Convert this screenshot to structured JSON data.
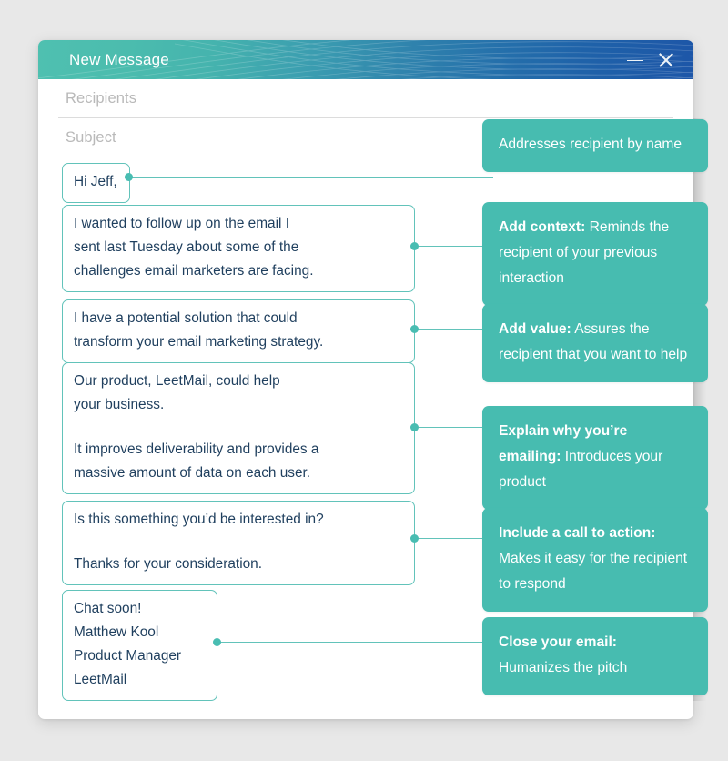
{
  "window": {
    "title": "New Message",
    "controls": [
      {
        "name": "minimize",
        "glyph": "—"
      },
      {
        "name": "close",
        "glyph": "✕"
      }
    ]
  },
  "fields": [
    {
      "name": "recipients",
      "placeholder": "Recipients",
      "value": ""
    },
    {
      "name": "subject",
      "placeholder": "Subject",
      "value": ""
    }
  ],
  "email_blocks": [
    {
      "id": "greeting",
      "lines": [
        "Hi Jeff,"
      ]
    },
    {
      "id": "context",
      "lines": [
        "I wanted to follow up on the email I",
        "sent last Tuesday about some of the",
        "challenges email marketers are facing."
      ]
    },
    {
      "id": "value",
      "lines": [
        "I have a potential solution that could",
        "transform  your email marketing strategy."
      ]
    },
    {
      "id": "product",
      "para1": [
        "Our product, LeetMail, could help",
        "your business."
      ],
      "para2": [
        "It improves deliverability and provides a",
        "massive amount of data on each user."
      ]
    },
    {
      "id": "cta",
      "para1": [
        "Is this something you’d be interested in?"
      ],
      "para2": [
        "Thanks for your consideration."
      ]
    },
    {
      "id": "signature",
      "lines": [
        "Chat soon!",
        "Matthew Kool",
        "Product Manager",
        "LeetMail"
      ]
    }
  ],
  "annotations": [
    {
      "id": "addresses-recipient",
      "bold": "",
      "text": "Addresses recipient by name"
    },
    {
      "id": "add-context",
      "bold": "Add context:",
      "text": " Reminds the recipient of your previous interaction"
    },
    {
      "id": "add-value",
      "bold": "Add value:",
      "text": " Assures the recipient that you want to help"
    },
    {
      "id": "explain-why",
      "bold": "Explain why you’re emailing:",
      "text": " Introduces your product"
    },
    {
      "id": "call-to-action",
      "bold": "Include a call to action:",
      "text": " Makes it easy for the recipient to respond"
    },
    {
      "id": "close-email",
      "bold": "Close your email:",
      "text": " Humanizes the pitch"
    }
  ],
  "colors": {
    "header_gradient_start": "#4fc0b0",
    "header_gradient_end": "#1d56a8",
    "annotation_bg": "#47bcb0",
    "box_border": "#62c3ba",
    "connector": "#62c3ba",
    "body_text": "#1f3f5e",
    "placeholder_text": "#b9b9b9",
    "page_bg": "#e8e8e8",
    "card_bg": "#ffffff"
  }
}
